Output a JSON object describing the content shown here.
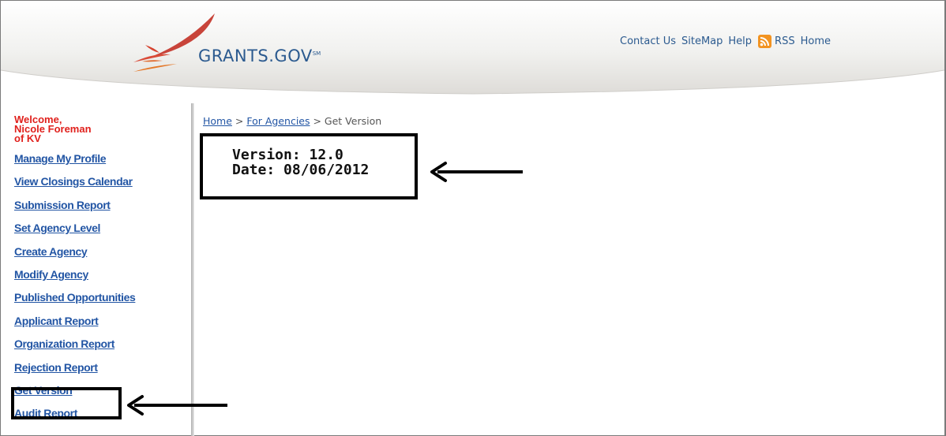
{
  "header": {
    "logo_text": "GRANTS.GOV",
    "logo_mark": "SM",
    "nav": {
      "contact": "Contact Us",
      "sitemap": "SiteMap",
      "help": "Help",
      "rss": "RSS",
      "home": "Home"
    }
  },
  "sidebar": {
    "welcome_line1": "Welcome,",
    "welcome_line2": "Nicole Foreman",
    "welcome_line3": "of KV",
    "items": [
      {
        "label": "Manage My Profile"
      },
      {
        "label": "View Closings Calendar"
      },
      {
        "label": "Submission Report"
      },
      {
        "label": "Set Agency Level"
      },
      {
        "label": "Create Agency"
      },
      {
        "label": "Modify Agency"
      },
      {
        "label": "Published Opportunities"
      },
      {
        "label": "Applicant Report"
      },
      {
        "label": "Organization Report"
      },
      {
        "label": "Rejection Report"
      },
      {
        "label": "Get Version"
      },
      {
        "label": "Audit Report"
      }
    ]
  },
  "breadcrumb": {
    "home": "Home",
    "sep1": " > ",
    "agencies": "For Agencies",
    "sep2": " > ",
    "current": "Get Version"
  },
  "version": {
    "version_line": "Version: 12.0",
    "date_line": "Date: 08/06/2012"
  },
  "colors": {
    "link": "#2255a4",
    "welcome": "#e0201c",
    "logo": "#2b5a8f",
    "rss": "#f29321"
  }
}
